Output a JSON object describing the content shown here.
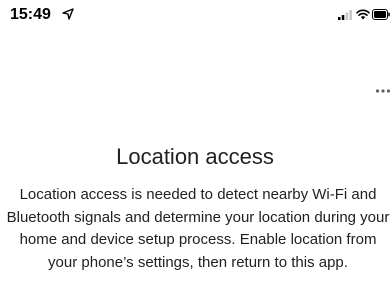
{
  "status_bar": {
    "time": "15:49",
    "icons": [
      "location-arrow-icon",
      "signal-icon",
      "wifi-icon",
      "battery-icon"
    ]
  },
  "toolbar": {
    "overflow_icon": "more-options-icon"
  },
  "dialog": {
    "title": "Location access",
    "body": "Location access is needed to detect nearby Wi-Fi and Bluetooth signals and determine your location during your home and device setup process. Enable location from your phone’s settings, then return to this app."
  },
  "colors": {
    "text": "#202124",
    "status_text": "#000000",
    "background": "#ffffff"
  }
}
